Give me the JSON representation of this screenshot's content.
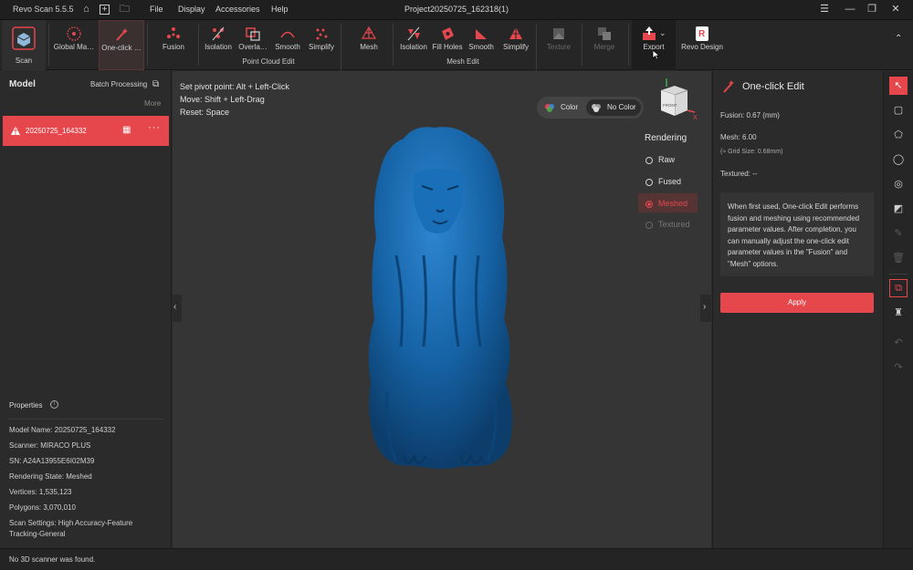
{
  "app": {
    "title": "Revo Scan 5.5.5",
    "project": "Project20250725_162318(1)"
  },
  "menu": [
    "File",
    "Display",
    "Accessories",
    "Help"
  ],
  "toolbar": {
    "scan": "Scan",
    "global_match": "Global Ma…",
    "one_click": "One-click …",
    "fusion": "Fusion",
    "pc_isolation": "Isolation",
    "overlap": "Overla…",
    "pc_smooth": "Smooth",
    "pc_simplify": "Simplify",
    "mesh": "Mesh",
    "m_isolation": "Isolation",
    "fill_holes": "Fill Holes",
    "m_smooth": "Smooth",
    "m_simplify": "Simplify",
    "texture": "Texture",
    "merge": "Merge",
    "export": "Export",
    "revo_design": "Revo Design",
    "group_pc": "Point Cloud Edit",
    "group_mesh": "Mesh Edit"
  },
  "left": {
    "title": "Model",
    "batch": "Batch Processing",
    "more": "More",
    "model_name": "20250725_164332",
    "properties_title": "Properties",
    "props": [
      "Model Name:  20250725_164332",
      "Scanner:  MIRACO PLUS",
      "SN:  A24A13955E6I02M39",
      "Rendering State:  Meshed",
      "Vertices:  1,535,123",
      "Polygons:  3,070,010",
      "Scan Settings:  High Accuracy-Feature",
      "Tracking-General"
    ]
  },
  "viewport": {
    "hint1_label": "Set pivot point:",
    "hint1_value": "Alt + Left-Click",
    "hint2_label": "Move:",
    "hint2_value": "Shift + Left-Drag",
    "hint3_label": "Reset:",
    "hint3_value": "Space",
    "color": "Color",
    "no_color": "No Color",
    "rendering_title": "Rendering",
    "render_options": [
      "Raw",
      "Fused",
      "Meshed",
      "Textured"
    ],
    "cube_face": "FRONT",
    "axis_x": "X",
    "model_color": "#1663a6"
  },
  "right": {
    "title": "One-click Edit",
    "fusion": "Fusion:   0.67 (mm)",
    "mesh": "Mesh:   6.00",
    "grid": "(≈ Grid Size: 0.68mm)",
    "textured": "Textured: --",
    "info": "When first used, One-click Edit performs fusion and meshing using recommended parameter values. After completion, you can manually adjust the one-click edit parameter values in the \"Fusion\" and \"Mesh\" options.",
    "apply": "Apply",
    "accent": "#e5474d"
  },
  "status": {
    "text": "No 3D scanner was found."
  }
}
